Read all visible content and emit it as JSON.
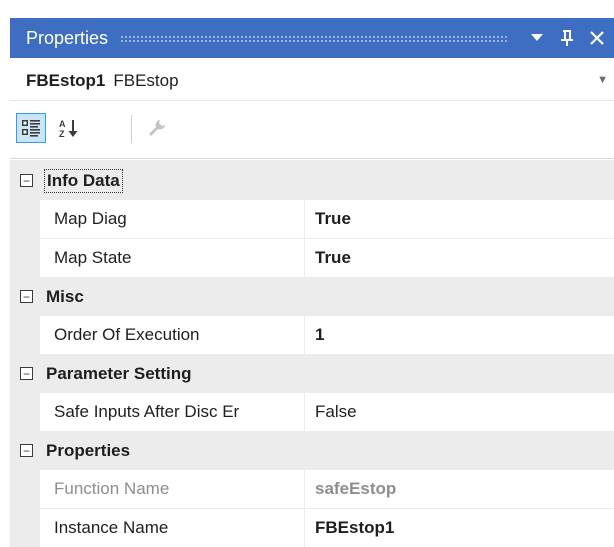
{
  "window": {
    "title": "Properties",
    "menu_glyph": "▾",
    "pin_glyph": "ᵖ",
    "close_glyph": "✕"
  },
  "selector": {
    "object_name": "FBEstop1",
    "object_type": "FBEstop"
  },
  "toolbar": {
    "categorized": "categorized-view-icon",
    "alphabetical": "alphabetical-sort-icon",
    "property_pages": "wrench-icon"
  },
  "grid": {
    "expander_glyph": "−",
    "categories": [
      {
        "label": "Info Data",
        "properties": [
          {
            "name": "Map Diag",
            "value": "True"
          },
          {
            "name": "Map State",
            "value": "True"
          }
        ]
      },
      {
        "label": "Misc",
        "properties": [
          {
            "name": "Order Of Execution",
            "value": "1"
          }
        ]
      },
      {
        "label": "Parameter Setting",
        "properties": [
          {
            "name": "Safe Inputs After Disc Er",
            "value": "False"
          }
        ]
      },
      {
        "label": "Properties",
        "properties": [
          {
            "name": "Function Name",
            "value": "safeEstop"
          },
          {
            "name": "Instance Name",
            "value": "FBEstop1"
          }
        ]
      }
    ]
  }
}
